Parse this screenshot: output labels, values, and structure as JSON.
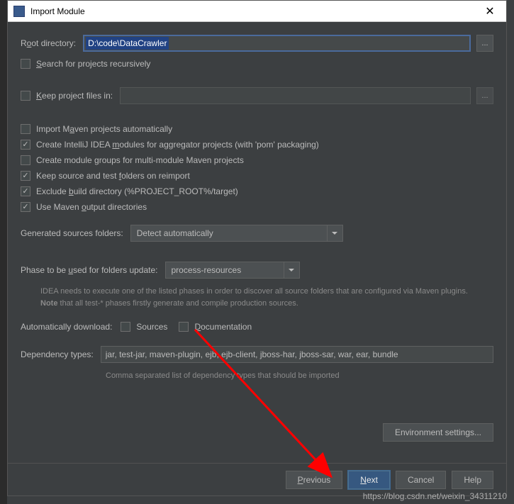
{
  "titlebar": {
    "title": "Import Module",
    "icon_letter": "IJ"
  },
  "root_directory": {
    "label_pre": "R",
    "label_u": "o",
    "label_post": "ot directory:",
    "value": "D:\\code\\DataCrawler",
    "browse": "..."
  },
  "search_recursive": {
    "label_u": "S",
    "label_post": "earch for projects recursively"
  },
  "keep_files": {
    "label_u": "K",
    "label_post": "eep project files in:",
    "value": "",
    "browse": "..."
  },
  "options": [
    {
      "checked": false,
      "pre": "Import M",
      "u": "a",
      "post": "ven projects automatically"
    },
    {
      "checked": true,
      "pre": "Create IntelliJ IDEA ",
      "u": "m",
      "post": "odules for aggregator projects (with 'pom' packaging)"
    },
    {
      "checked": false,
      "pre": "Create module ",
      "u": "g",
      "post": "roups for multi-module Maven projects"
    },
    {
      "checked": true,
      "pre": "Keep source and test ",
      "u": "f",
      "post": "olders on reimport"
    },
    {
      "checked": true,
      "pre": "Exclude ",
      "u": "b",
      "post": "uild directory (%PROJECT_ROOT%/target)"
    },
    {
      "checked": true,
      "pre": "Use Maven ",
      "u": "o",
      "post": "utput directories"
    }
  ],
  "generated_sources": {
    "label": "Generated sources folders:",
    "value": "Detect automatically"
  },
  "phase": {
    "label_pre": "Phase to be ",
    "label_u": "u",
    "label_post": "sed for folders update:",
    "value": "process-resources",
    "help1": "IDEA needs to execute one of the listed phases in order to discover all source folders that are configured via Maven plugins.",
    "help2_bold": "Note",
    "help2_rest": " that all test-* phases firstly generate and compile production sources."
  },
  "auto_download": {
    "label": "Automatically download:",
    "sources": "Sources",
    "docs_u": "D",
    "docs_post": "ocumentation"
  },
  "dependency": {
    "label": "Dependency types:",
    "value": "jar, test-jar, maven-plugin, ejb, ejb-client, jboss-har, jboss-sar, war, ear, bundle",
    "help": "Comma separated list of dependency types that should be imported"
  },
  "env_button": "Environment settings...",
  "buttons": {
    "previous_u": "P",
    "previous_post": "revious",
    "next_u": "N",
    "next_post": "ext",
    "cancel": "Cancel",
    "help": "Help"
  },
  "watermark": "https://blog.csdn.net/weixin_34311210"
}
